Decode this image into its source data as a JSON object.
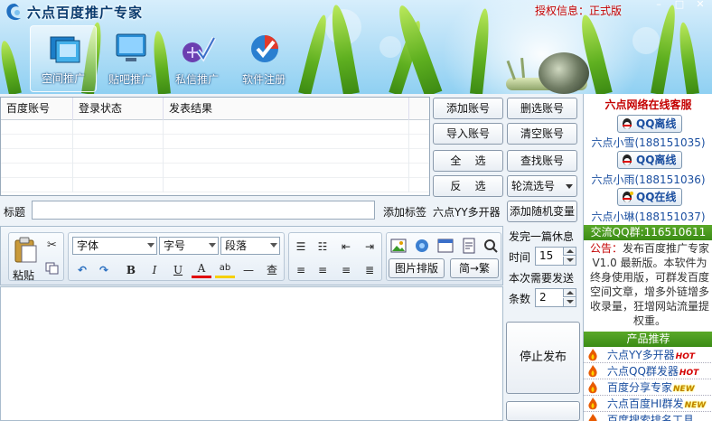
{
  "header": {
    "app_title": "六点百度推广专家",
    "license_text": "授权信息：正式版",
    "nav": [
      {
        "label": "空间推广"
      },
      {
        "label": "贴吧推广"
      },
      {
        "label": "私信推广"
      },
      {
        "label": "软件注册"
      }
    ],
    "window_controls": {
      "minimize": "–",
      "maximize": "□",
      "close": "✕"
    }
  },
  "accounts": {
    "columns": [
      "百度账号",
      "登录状态",
      "发表结果"
    ],
    "rows": []
  },
  "account_buttons": {
    "add": "添加账号",
    "import": "导入账号",
    "select_all": "全    选",
    "invert": "反    选",
    "delete_selected": "删选账号",
    "clear": "清空账号",
    "find": "查找账号",
    "rotate_select": "轮流选号"
  },
  "title_row": {
    "label": "标题",
    "value": "",
    "add_tag": "添加标签",
    "yy_link": "六点YY多开器",
    "add_random_var": "添加随机变量"
  },
  "toolbar": {
    "paste": "粘贴",
    "font": "字体",
    "font_size": "字号",
    "paragraph": "段落",
    "find": "查",
    "image_layout": "图片排版",
    "convert": "简→繁"
  },
  "publish": {
    "rest_label": "发完一篇休息",
    "time_label": "时间",
    "time_value": "15",
    "count_label_1": "本次需要发送",
    "count_label_2": "条数",
    "count_value": "2",
    "stop_button": "停止发布"
  },
  "sidebar": {
    "heading": "六点网络在线客服",
    "agents": [
      {
        "status": "QQ离线",
        "name": "六点小雪(188151035)"
      },
      {
        "status": "QQ离线",
        "name": "六点小雨(188151036)"
      },
      {
        "status": "QQ在线",
        "name": "六点小琳(188151037)"
      }
    ],
    "qq_group": "交流QQ群:116510611",
    "notice_prefix": "公告：",
    "notice_text": "发布百度推广专家V1.0 最新版。本软件为终身使用版，可群发百度空间文章，增多外链增多收录量，狂增网站流量提权重。",
    "products_heading": "产品推荐",
    "products": [
      {
        "name": "六点YY多开器",
        "tag": "HOT"
      },
      {
        "name": "六点QQ群发器",
        "tag": "HOT"
      },
      {
        "name": "百度分享专家",
        "tag": "NEW"
      },
      {
        "name": "六点百度HI群发",
        "tag": "NEW"
      },
      {
        "name": "百度搜索排名工具",
        "tag": ""
      }
    ]
  },
  "colors": {
    "accent_red": "#c40000",
    "link_blue": "#1b4fa0",
    "sidebar_green": "#3b8c16"
  }
}
